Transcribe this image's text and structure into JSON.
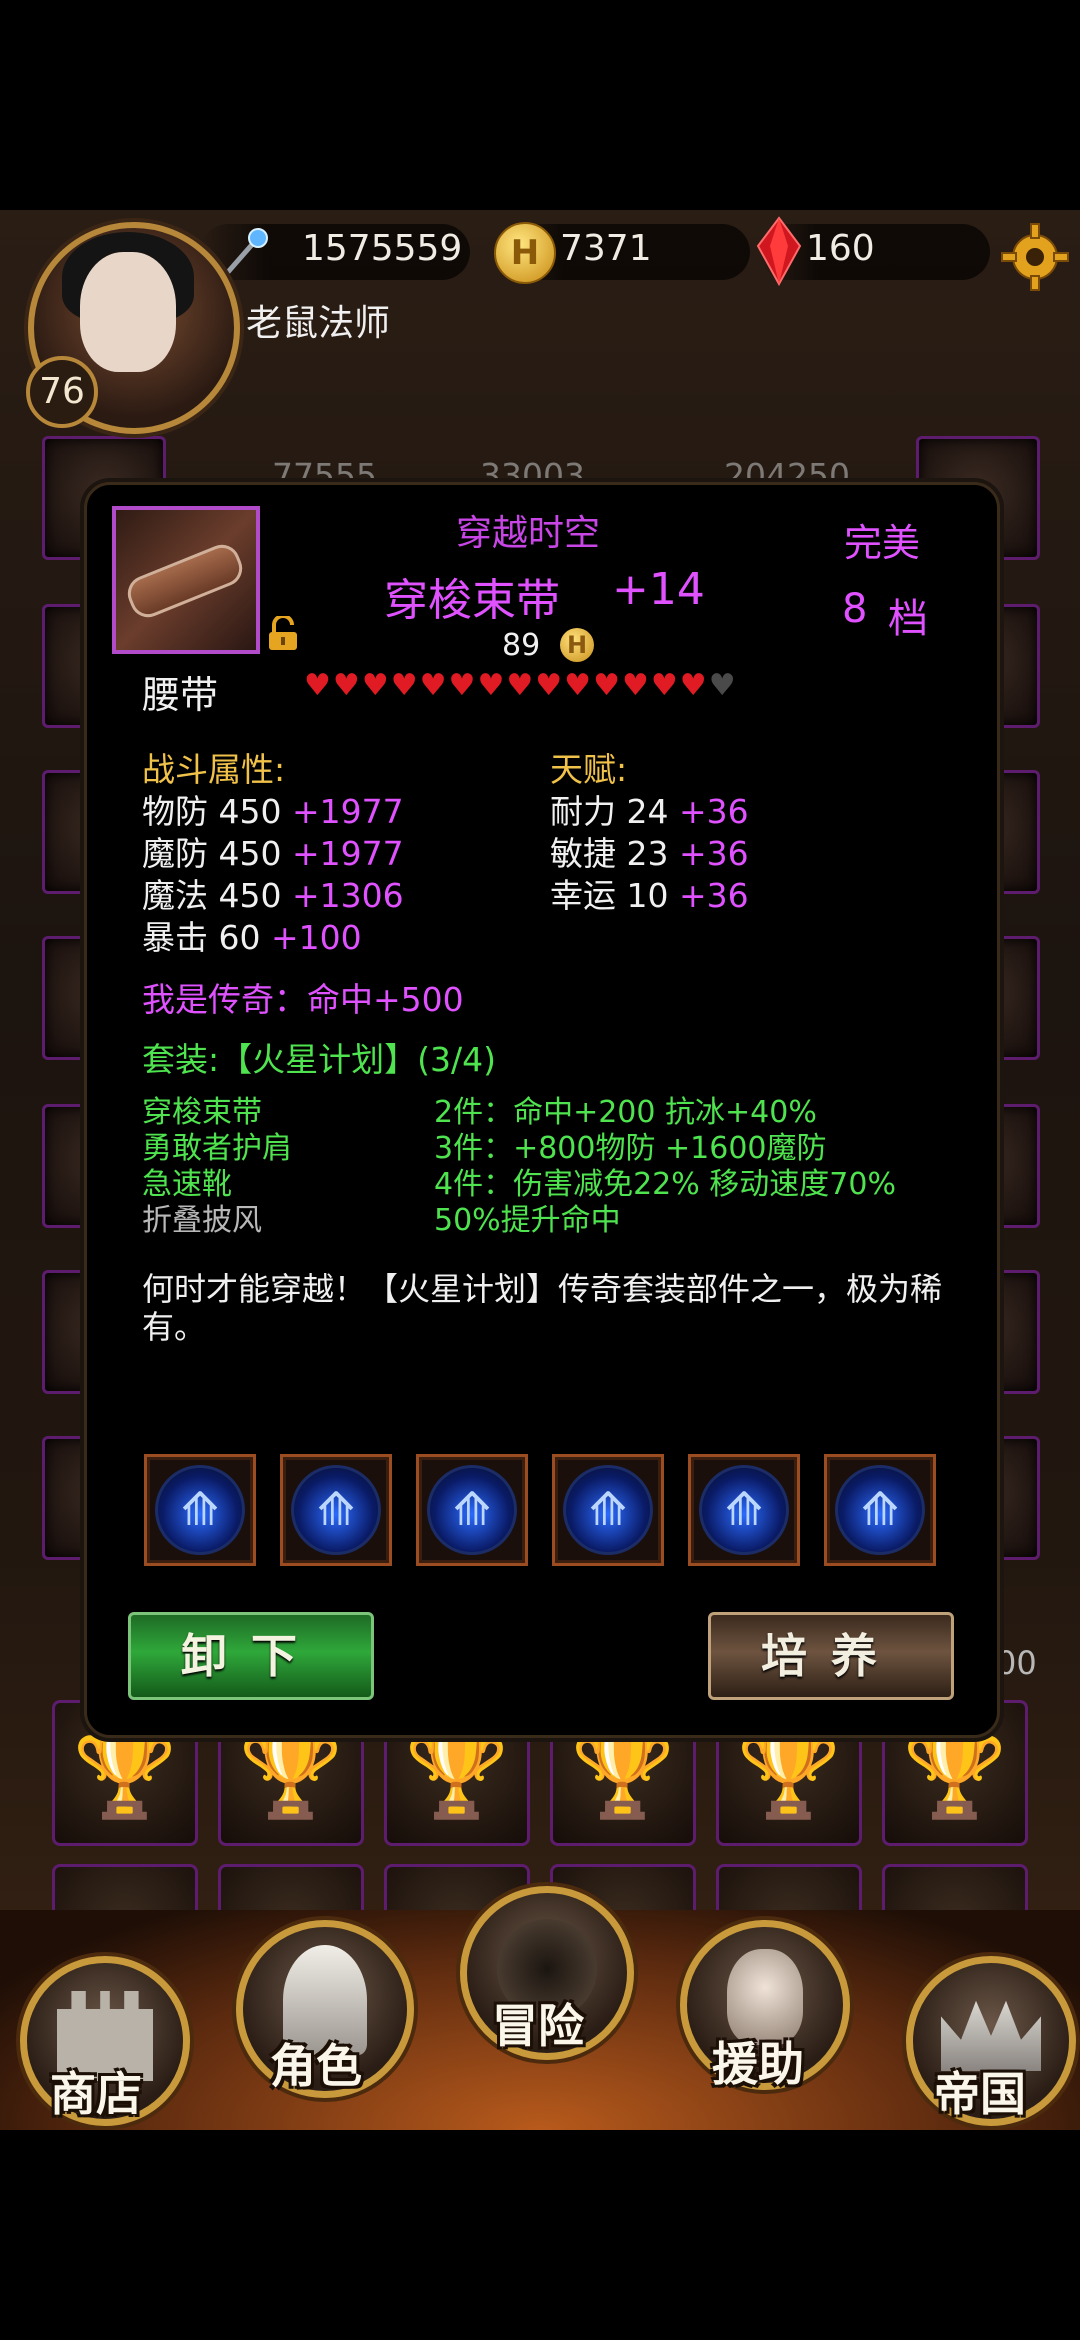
{
  "header": {
    "player_name": "老鼠法师",
    "level": "76",
    "power": "1575559",
    "gold": "7371",
    "gems": "160"
  },
  "background": {
    "stat_row": [
      "77555",
      "33003",
      "204250"
    ],
    "partial_number": "00"
  },
  "item": {
    "set_name": "穿越时空",
    "name": "穿梭束带",
    "enhance": "+14",
    "quality": "完美",
    "grade": "8",
    "grade_unit": "档",
    "price": "89",
    "slot": "腰带",
    "hearts_filled": 14,
    "hearts_total": 15
  },
  "combat": {
    "title": "战斗属性:",
    "stats": [
      {
        "label": "物防",
        "base": "450",
        "bonus": "+1977"
      },
      {
        "label": "魔防",
        "base": "450",
        "bonus": "+1977"
      },
      {
        "label": "魔法",
        "base": "450",
        "bonus": "+1306"
      },
      {
        "label": "暴击",
        "base": "60",
        "bonus": "+100"
      }
    ]
  },
  "talent": {
    "title": "天赋:",
    "stats": [
      {
        "label": "耐力",
        "base": "24",
        "bonus": "+36"
      },
      {
        "label": "敏捷",
        "base": "23",
        "bonus": "+36"
      },
      {
        "label": "幸运",
        "base": "10",
        "bonus": "+36"
      }
    ]
  },
  "legend": "我是传奇：命中+500",
  "set": {
    "title": "套装:【火星计划】(3/4)",
    "pieces": [
      "穿梭束带",
      "勇敢者护肩",
      "急速靴",
      "折叠披风"
    ],
    "bonuses": [
      "2件：命中+200 抗冰+40%",
      "3件：+800物防 +1600魔防",
      "4件：伤害减免22% 移动速度70%",
      "50%提升命中"
    ]
  },
  "description": "何时才能穿越！【火星计划】传奇套装部件之一，极为稀有。",
  "buttons": {
    "unequip": "卸下",
    "cultivate": "培养"
  },
  "nav": {
    "shop": "商店",
    "character": "角色",
    "adventure": "冒险",
    "support": "援助",
    "empire": "帝国"
  },
  "colors": {
    "purple": "#c846e6",
    "gold": "#f1c24a",
    "green": "#4fe44f",
    "pink": "#e052ff"
  }
}
